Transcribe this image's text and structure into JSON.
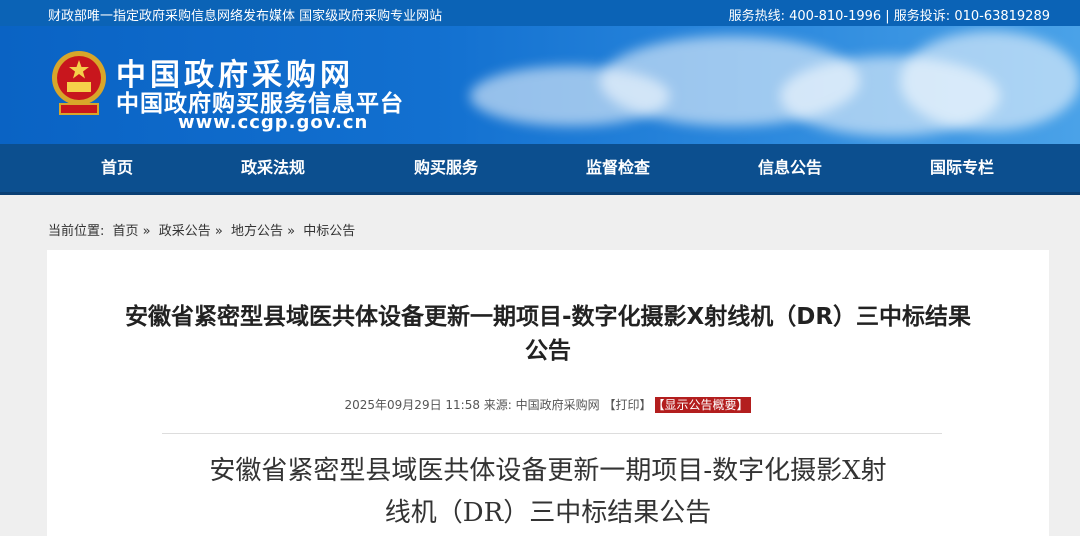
{
  "topbar": {
    "slogan": "财政部唯一指定政府采购信息网络发布媒体 国家级政府采购专业网站",
    "hotline": "服务热线: 400-810-1996  |  服务投诉: 010-63819289"
  },
  "header": {
    "title_main": "中国政府采购网",
    "title_sub": "中国政府购买服务信息平台",
    "url": "www.ccgp.gov.cn"
  },
  "nav": [
    "首页",
    "政采法规",
    "购买服务",
    "监督检查",
    "信息公告",
    "国际专栏"
  ],
  "breadcrumb": {
    "label": "当前位置:",
    "items": [
      "首页 »",
      "政采公告 »",
      "地方公告 »",
      "中标公告"
    ]
  },
  "article": {
    "title_line1": "安徽省紧密型县域医共体设备更新一期项目-数字化摄影X射线机（DR）三中标结果",
    "title_line2": "公告",
    "meta": "2025年09月29日 11:58 来源: 中国政府采购网 【打印】",
    "summary_tag": "【显示公告概要】",
    "doc_line1": "安徽省紧密型县域医共体设备更新一期项目-数字化摄影X射",
    "doc_line2": "线机（DR）三中标结果公告"
  }
}
